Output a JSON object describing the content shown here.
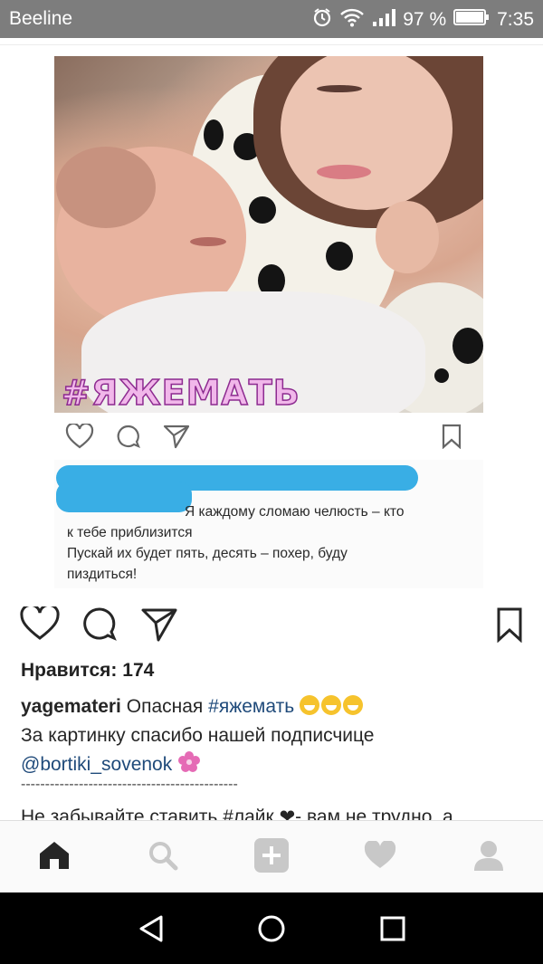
{
  "status_bar": {
    "carrier": "Beeline",
    "battery": "97 %",
    "time": "7:35"
  },
  "post_image": {
    "hashtag_overlay": "#ЯЖЕМАТЬ",
    "inner_caption": [
      "Я каждому сломаю челюсть – кто",
      "к тебе приблизится",
      "Пускай их будет пять, десять – похер, буду",
      "пиздиться!"
    ]
  },
  "post": {
    "likes": "Нравится: 174",
    "username": "yagemateri",
    "caption_word": "Опасная",
    "caption_tag": "#яжемать",
    "caption_line2": "За картинку спасибо нашей подписчице",
    "mention": "@bortiki_sovenok",
    "dashes": "---------------------------------------------",
    "cut_prefix": "Не забывайте ставить",
    "cut_tag": "#лайк",
    "cut_suffix": "- вам не трудно, а"
  },
  "colors": {
    "status_bar": "#7d7d7d",
    "hashtag_link": "#1f4a7a",
    "censor": "#39aee5",
    "hashtag_fill": "#f1b7ea"
  }
}
